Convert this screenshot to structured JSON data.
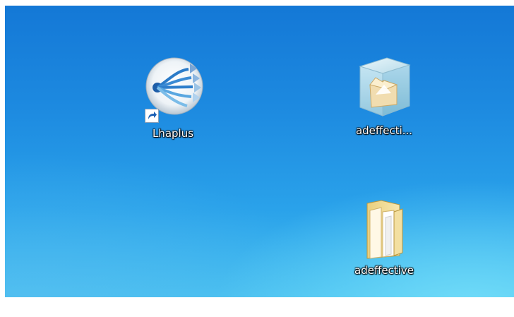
{
  "desktop": {
    "icons": [
      {
        "label": "Lhaplus",
        "icon": "lhaplus-app-icon",
        "shortcut": true
      },
      {
        "label": "adeffecti...",
        "icon": "ice-cube-folder-icon",
        "shortcut": false
      },
      {
        "label": "adeffective",
        "icon": "folder-icon",
        "shortcut": false
      }
    ]
  },
  "colors": {
    "wallpaper_top": "#1478d6",
    "wallpaper_bottom": "#48c0f0",
    "label_text": "#ffffff"
  }
}
